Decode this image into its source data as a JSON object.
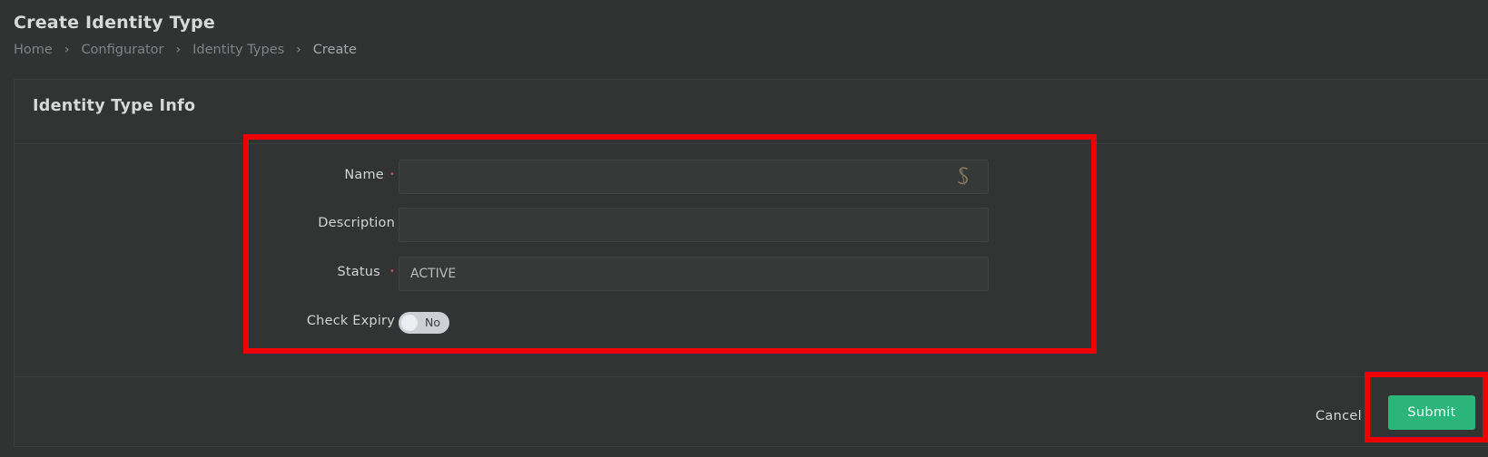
{
  "page": {
    "title": "Create Identity Type"
  },
  "breadcrumb": {
    "items": [
      "Home",
      "Configurator",
      "Identity Types",
      "Create"
    ],
    "separator": "›"
  },
  "card": {
    "title": "Identity Type Info"
  },
  "form": {
    "name": {
      "label": "Name",
      "required_marker": "•",
      "value": "",
      "placeholder": "",
      "icon": "password-manager-icon"
    },
    "description": {
      "label": "Description",
      "value": "",
      "placeholder": ""
    },
    "status": {
      "label": "Status",
      "required_marker": "•",
      "value": "ACTIVE"
    },
    "check_expiry": {
      "label": "Check Expiry",
      "toggle_text": "No",
      "enabled": false
    }
  },
  "actions": {
    "cancel_label": "Cancel",
    "submit_label": "Submit"
  },
  "colors": {
    "background": "#303332",
    "accent": "#2cb57b",
    "required": "#c0504d",
    "highlight": "#ee0000"
  }
}
